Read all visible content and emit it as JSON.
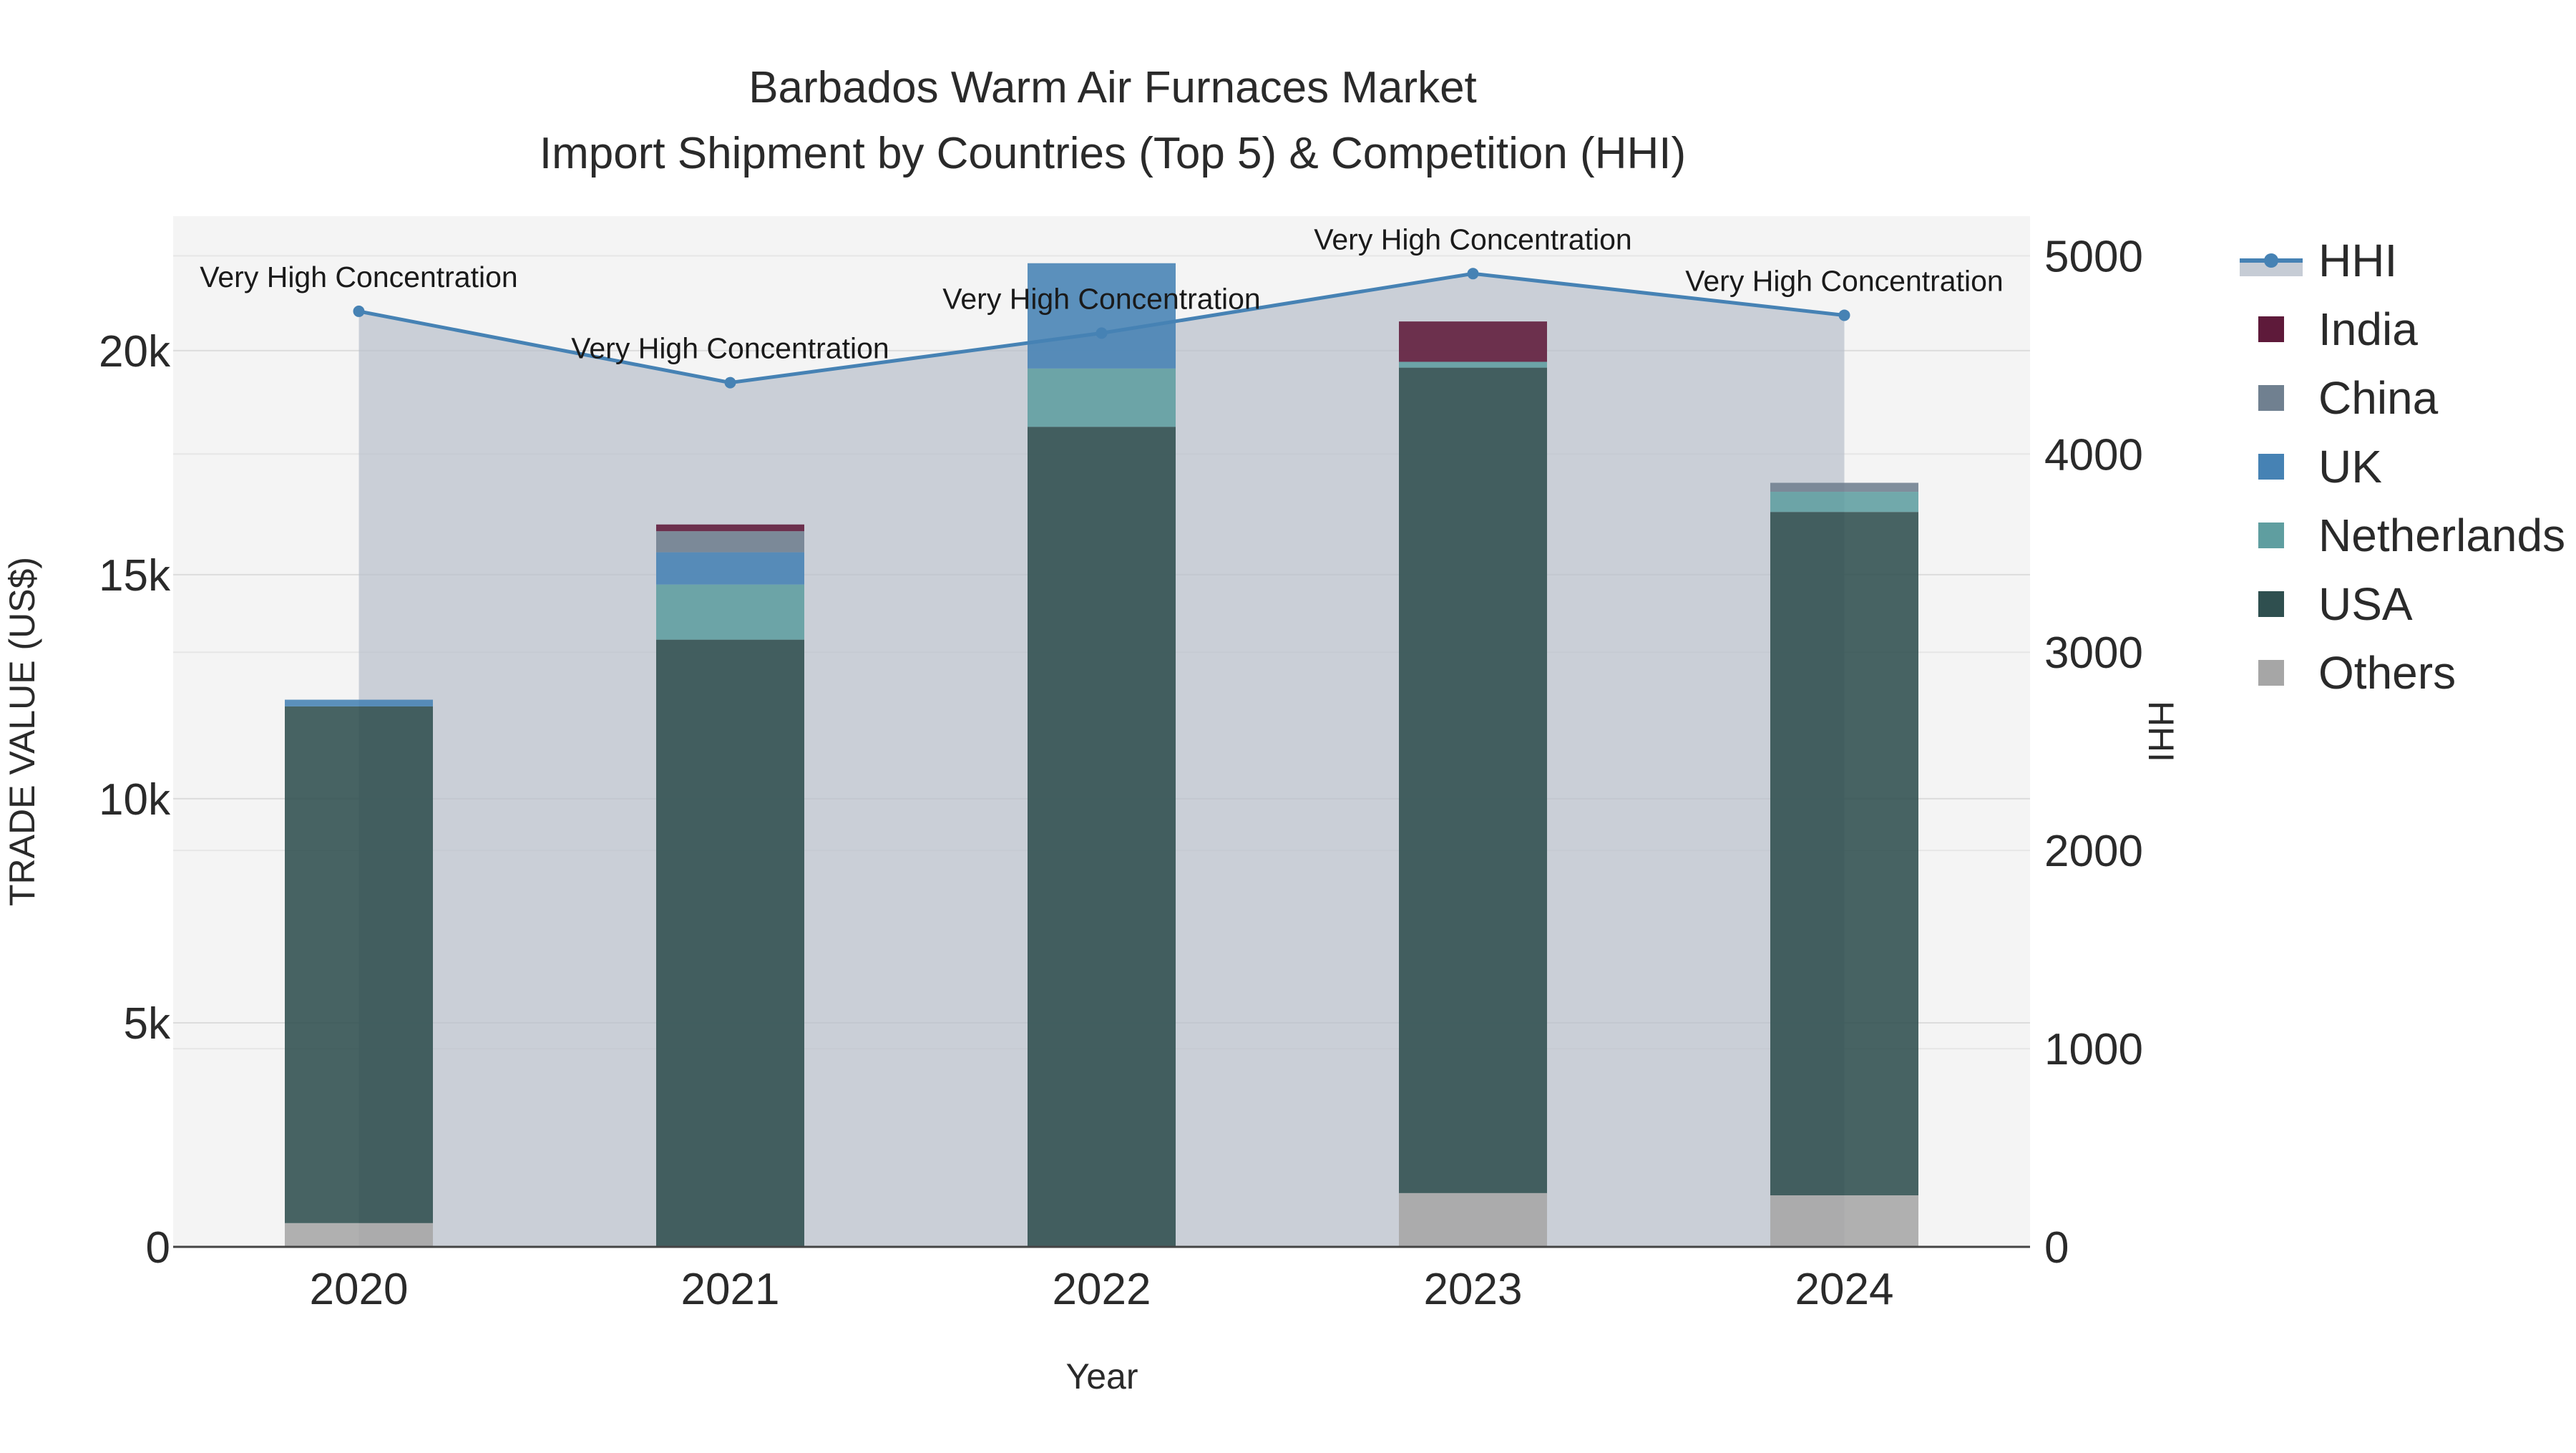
{
  "chart_data": {
    "type": "bar",
    "title": "Barbados Warm Air Furnaces Market",
    "subtitle": "Import Shipment by Countries (Top 5) & Competition (HHI)",
    "xlabel": "Year",
    "ylabel": "TRADE VALUE (US$)",
    "y2label": "HHI",
    "categories": [
      "2020",
      "2021",
      "2022",
      "2023",
      "2024"
    ],
    "ylim": [
      0,
      23000
    ],
    "y_ticks": [
      0,
      5000,
      10000,
      15000,
      20000
    ],
    "y_tick_labels": [
      "0",
      "5k",
      "10k",
      "15k",
      "20k"
    ],
    "y2lim": [
      0,
      5200
    ],
    "y2_ticks": [
      0,
      1000,
      2000,
      3000,
      4000,
      5000
    ],
    "y2_tick_labels": [
      "0",
      "1000",
      "2000",
      "3000",
      "4000",
      "5000"
    ],
    "stacked": true,
    "series": [
      {
        "name": "Others",
        "color": "#a6a6a6",
        "values": [
          530,
          0,
          0,
          1200,
          1150
        ]
      },
      {
        "name": "USA",
        "color": "#2f4f4f",
        "values": [
          11530,
          13550,
          18300,
          18420,
          15250
        ]
      },
      {
        "name": "Netherlands",
        "color": "#5f9ea0",
        "values": [
          0,
          1230,
          1300,
          130,
          450
        ]
      },
      {
        "name": "UK",
        "color": "#4682b4",
        "values": [
          150,
          720,
          2350,
          0,
          0
        ]
      },
      {
        "name": "China",
        "color": "#708090",
        "values": [
          0,
          470,
          0,
          0,
          200
        ]
      },
      {
        "name": "India",
        "color": "#5e1a3a",
        "values": [
          0,
          150,
          0,
          900,
          0
        ]
      }
    ],
    "hhi": {
      "name": "HHI",
      "color": "#4682b4",
      "values": [
        4720,
        4360,
        4610,
        4910,
        4700
      ],
      "labels": [
        "Very High Concentration",
        "Very High Concentration",
        "Very High Concentration",
        "Very High Concentration",
        "Very High Concentration"
      ]
    },
    "legend": {
      "position": "right",
      "items": [
        "HHI",
        "India",
        "China",
        "UK",
        "Netherlands",
        "USA",
        "Others"
      ]
    },
    "grid": true
  }
}
